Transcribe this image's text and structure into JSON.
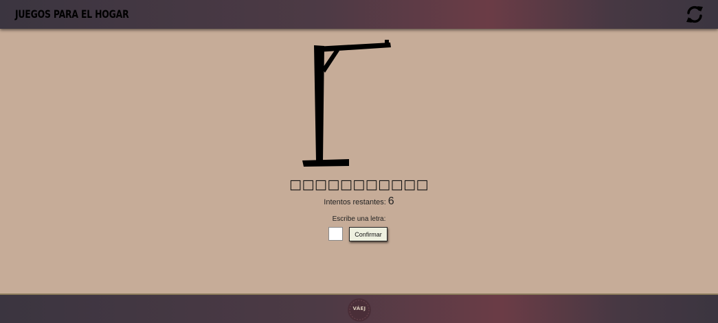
{
  "header": {
    "title": "JUEGOS PARA EL HOGAR",
    "refresh_icon": "refresh-icon"
  },
  "game": {
    "word_mask": "□□□□□□□□□□□",
    "tries_label": "Intentos restantes:",
    "tries_remaining": "6",
    "prompt": "Escribe una letra:",
    "letter_value": "",
    "confirm_label": "Confirmar"
  },
  "footer": {
    "logo_text": "VÁEJ"
  },
  "colors": {
    "background": "#c6ac98",
    "bar_dark": "#3b3540",
    "bar_accent": "#6b3c46",
    "button_bg": "#eef0e0"
  }
}
